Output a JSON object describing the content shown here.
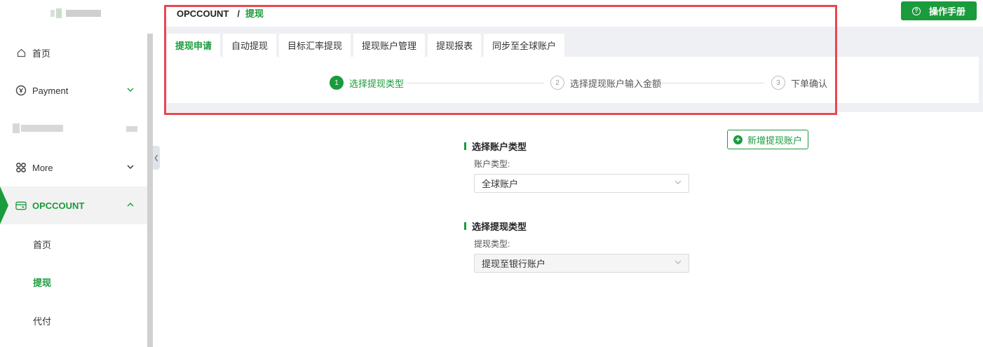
{
  "sidebar": {
    "items": [
      {
        "label": "首页",
        "icon": "home-icon"
      },
      {
        "label": "Payment",
        "icon": "yen-circle-icon"
      },
      {
        "label": "More",
        "icon": "grid-icon"
      },
      {
        "label": "OPCCOUNT",
        "icon": "card-icon"
      }
    ],
    "sub_items": [
      {
        "label": "首页"
      },
      {
        "label": "提现"
      },
      {
        "label": "代付"
      }
    ]
  },
  "breadcrumb": {
    "root": "OPCCOUNT",
    "separator": "/",
    "current": "提现"
  },
  "header": {
    "manual_button": "操作手册"
  },
  "tabs": [
    {
      "label": "提现申请"
    },
    {
      "label": "自动提现"
    },
    {
      "label": "目标汇率提现"
    },
    {
      "label": "提现账户管理"
    },
    {
      "label": "提现报表"
    },
    {
      "label": "同步至全球账户"
    }
  ],
  "steps": [
    {
      "num": "1",
      "label": "选择提现类型"
    },
    {
      "num": "2",
      "label": "选择提现账户输入金额"
    },
    {
      "num": "3",
      "label": "下单确认"
    }
  ],
  "form": {
    "add_account_button": "新增提现账户",
    "account_section": {
      "title": "选择账户类型",
      "label": "账户类型:",
      "value": "全球账户"
    },
    "withdraw_section": {
      "title": "选择提现类型",
      "label": "提现类型:",
      "value": "提现至银行账户"
    }
  },
  "colors": {
    "accent": "#1a9b3c",
    "highlight_border": "#e8474f"
  }
}
